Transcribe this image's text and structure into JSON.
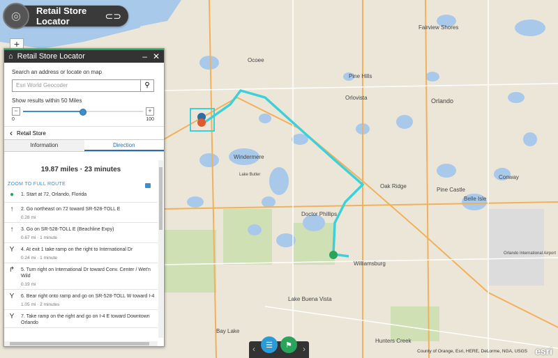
{
  "app": {
    "title": "Retail Store Locator",
    "link_icon": "link-icon",
    "logo_icon": "compass-logo-icon"
  },
  "map": {
    "zoom_in_label": "+",
    "places": [
      {
        "name": "Ocoee"
      },
      {
        "name": "Pine Hills"
      },
      {
        "name": "Orlovista"
      },
      {
        "name": "Orlando"
      },
      {
        "name": "Windermere"
      },
      {
        "name": "Lake Butler"
      },
      {
        "name": "Oak Ridge"
      },
      {
        "name": "Pine Castle"
      },
      {
        "name": "Belle Isle"
      },
      {
        "name": "Conway"
      },
      {
        "name": "Doctor Phillips"
      },
      {
        "name": "Williamsburg"
      },
      {
        "name": "Lake Buena Vista"
      },
      {
        "name": "Bay Lake"
      },
      {
        "name": "Hunters Creek"
      },
      {
        "name": "Fairview Shores"
      },
      {
        "name": "Orlando International Airport"
      }
    ],
    "attribution": "County of Orange, Esri, HERE, DeLorme, NGA, USGS",
    "esri_logo": "esri"
  },
  "panel": {
    "title": "Retail Store Locator",
    "header_icon": "store-icon",
    "search_label": "Search an address or locate on map",
    "search_placeholder": "Esri World Geocoder",
    "radius_label": "Show results within 50 Miles",
    "slider": {
      "min": "0",
      "max": "100",
      "value": 50
    },
    "back_label": "Retail Store",
    "tabs": [
      {
        "label": "Information"
      },
      {
        "label": "Direction"
      }
    ],
    "active_tab": "Direction",
    "summary": "19.87 miles · 23 minutes",
    "zoom_full_route": "ZOOM TO FULL ROUTE",
    "steps": [
      {
        "icon": "start-pin-icon",
        "text": "1. Start at 72, Orlando, Florida",
        "meta": ""
      },
      {
        "icon": "straight-arrow-icon",
        "text": "2. Go northeast on 72 toward SR-528-TOLL E",
        "meta": "0.28 mi"
      },
      {
        "icon": "straight-arrow-icon",
        "text": "3. Go on SR-528-TOLL E (Beachline Expy)",
        "meta": "0.67 mi · 1 minute"
      },
      {
        "icon": "fork-right-icon",
        "text": "4. At exit 1 take ramp on the right to International Dr",
        "meta": "0.24 mi · 1 minute"
      },
      {
        "icon": "turn-right-icon",
        "text": "5. Turn right on International Dr toward Conv. Center / Wet'n Wild",
        "meta": "0.19 mi"
      },
      {
        "icon": "fork-right-icon",
        "text": "6. Bear right onto ramp and go on SR-528-TOLL W toward I-4",
        "meta": "1.05 mi · 2 minutes"
      },
      {
        "icon": "fork-right-icon",
        "text": "7. Take ramp on the right and go on I-4 E toward Downtown Orlando",
        "meta": ""
      }
    ]
  },
  "bottom_bar": {
    "prev": "‹",
    "next": "›"
  },
  "colors": {
    "route": "#3ed0d8",
    "panel_header": "#333333",
    "accent": "#3f8dca",
    "water": "#a9c9ea",
    "park": "#cfe0b5"
  }
}
